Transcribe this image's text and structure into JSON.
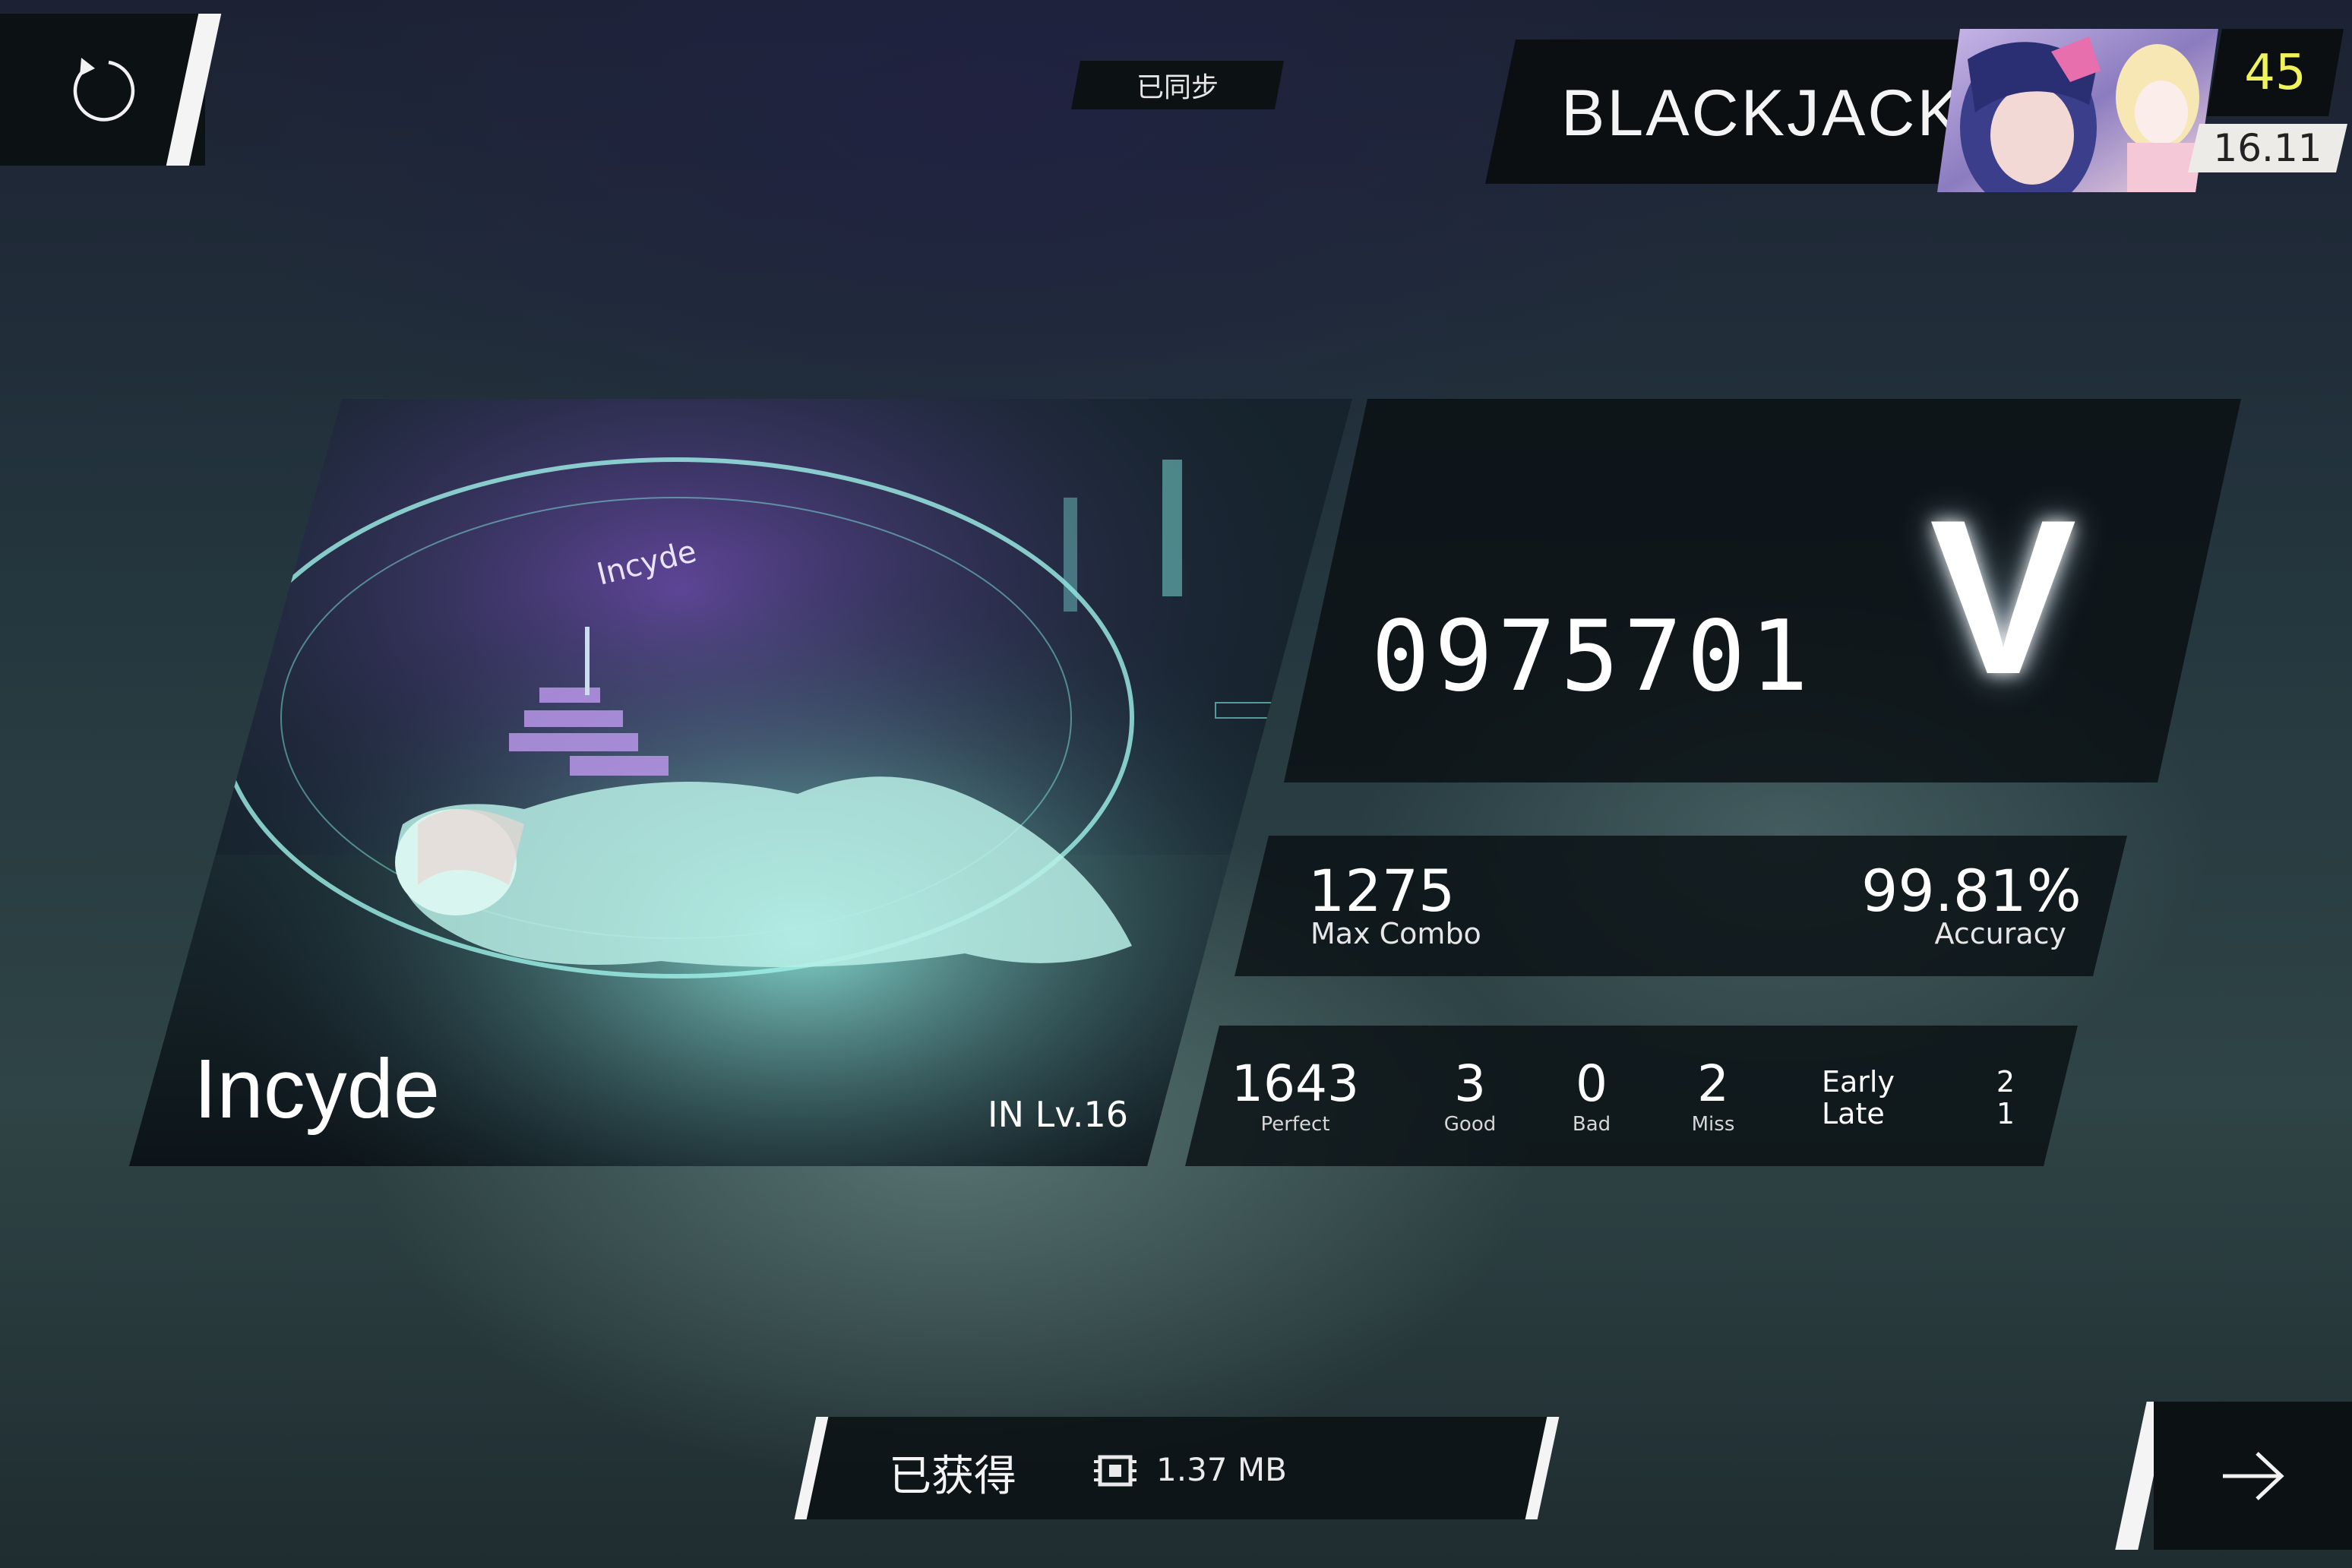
{
  "header": {
    "retry_icon": "retry-icon",
    "sync_status": "已同步",
    "player": {
      "name": "BLACKJACK",
      "level": "45",
      "rating": "16.11"
    }
  },
  "song": {
    "title": "Incyde",
    "difficulty": "IN  Lv.16",
    "art_text": "Incyde"
  },
  "result": {
    "score": "0975701",
    "rank": "V",
    "max_combo": "1275",
    "max_combo_label": "Max Combo",
    "accuracy": "99.81%",
    "accuracy_label": "Accuracy"
  },
  "judgements": {
    "perfect": {
      "value": "1643",
      "label": "Perfect"
    },
    "good": {
      "value": "3",
      "label": "Good"
    },
    "bad": {
      "value": "0",
      "label": "Bad"
    },
    "miss": {
      "value": "2",
      "label": "Miss"
    },
    "early_label": "Early",
    "late_label": "Late",
    "early": "2",
    "late": "1"
  },
  "footer": {
    "download_status": "已获得",
    "storage_icon": "storage-chip-icon",
    "download_size": "1.37 MB",
    "next_icon": "arrow-right-icon"
  },
  "colors": {
    "level_text": "#f1f35a",
    "rating_bg": "#ecebe7",
    "panel_bg": "#0a1014",
    "accent_cyan": "#7fe8e0"
  }
}
